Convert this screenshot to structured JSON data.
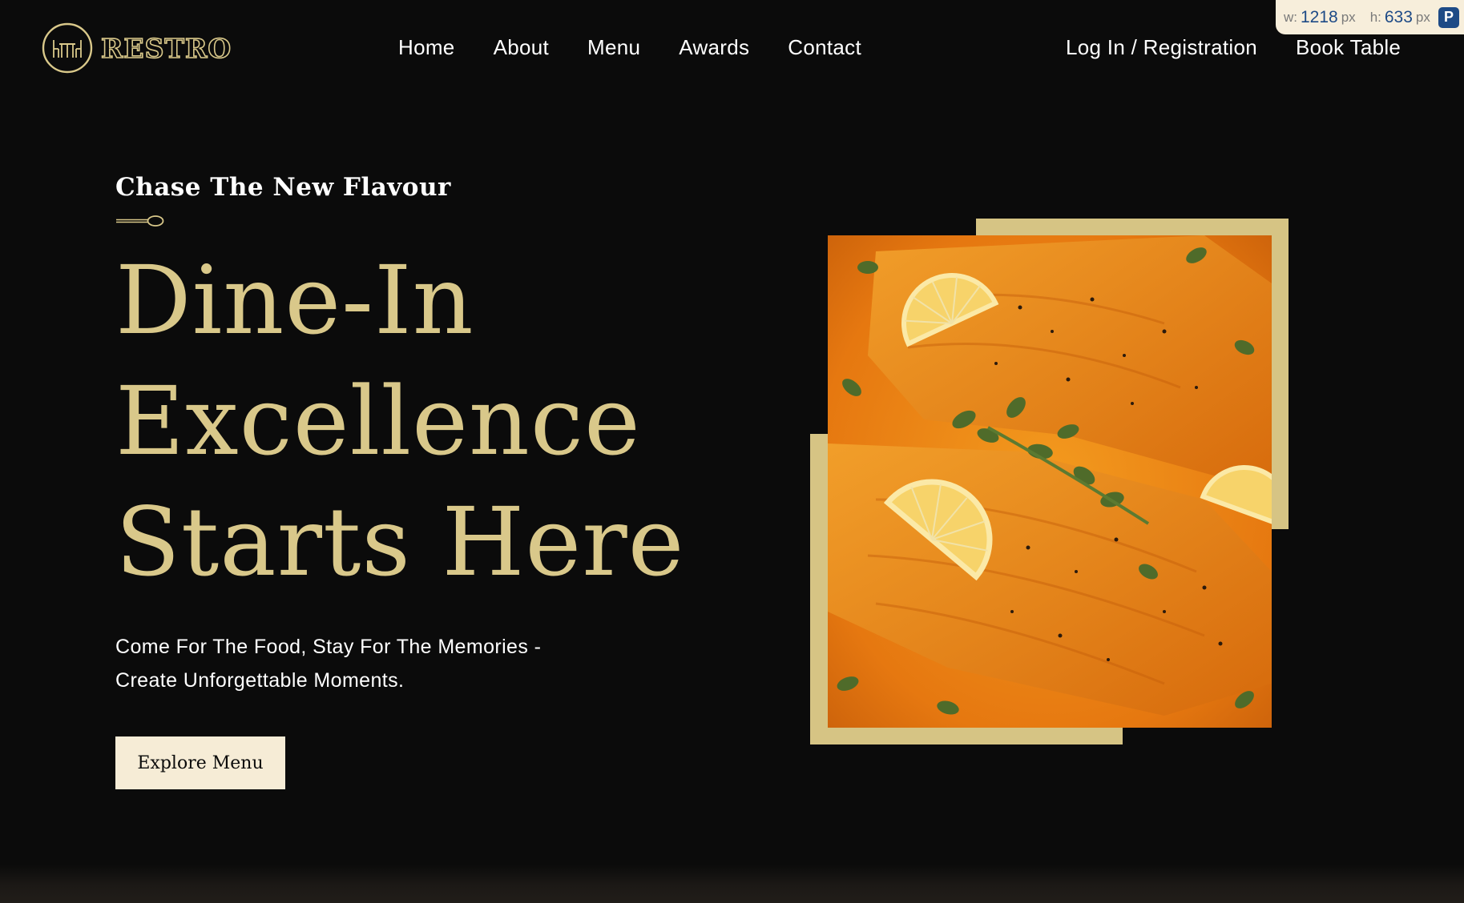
{
  "brand": {
    "name": "Restro",
    "accent_color": "#d9c88a",
    "logo_icon": "restaurant-table-icon"
  },
  "nav": {
    "items": [
      {
        "label": "Home"
      },
      {
        "label": "About"
      },
      {
        "label": "Menu"
      },
      {
        "label": "Awards"
      },
      {
        "label": "Contact"
      }
    ],
    "login_label": "Log In / Registration",
    "book_label": "Book Table"
  },
  "dimension_overlay": {
    "w_label": "w:",
    "w_value": "1218",
    "w_unit": "px",
    "h_label": "h:",
    "h_value": "633",
    "h_unit": "px",
    "badge": "P"
  },
  "hero": {
    "eyebrow": "Chase The New Flavour",
    "divider_icon": "spoon-icon",
    "headline_lines": [
      "Dine-In",
      "Excellence",
      "Starts Here"
    ],
    "subtext_lines": [
      "Come For The Food, Stay For The Memories -",
      "Create Unforgettable Moments."
    ],
    "cta_label": "Explore Menu",
    "image_icon": "salmon-dish-image"
  },
  "colors": {
    "background": "#0b0b0b",
    "accent": "#d9c88a",
    "frame": "#d6c484",
    "button_bg": "#f6ecd6"
  }
}
